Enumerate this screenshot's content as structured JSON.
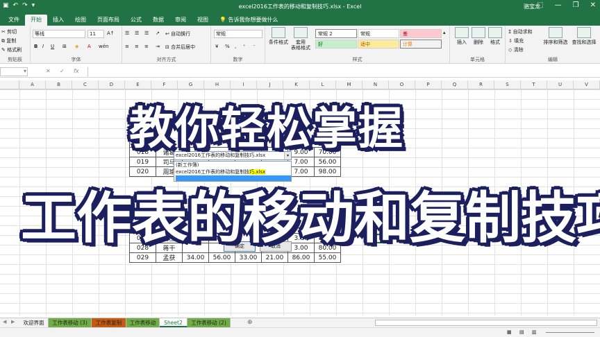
{
  "window": {
    "title": "excel2016工作表的移动和复制技巧.xlsx - Excel",
    "user": "骆宝龙",
    "controls": [
      "⬚",
      "—",
      "❐",
      "✕"
    ]
  },
  "tabs": [
    "文件",
    "开始",
    "插入",
    "绘图",
    "页面布局",
    "公式",
    "数据",
    "审阅",
    "视图"
  ],
  "tell_me": "告诉我你想要做什么",
  "ribbon": {
    "clipboard": {
      "label": "剪贴板",
      "cut": "剪切",
      "copy": "复制",
      "painter": "格式刷"
    },
    "font": {
      "label": "字体",
      "name": "等线",
      "size": "11",
      "bold": "B",
      "italic": "I",
      "underline": "U",
      "grow": "A↑",
      "shrink": "A↓",
      "wen": "wén"
    },
    "align": {
      "label": "对齐方式",
      "wrap": "自动换行",
      "merge": "合并后居中"
    },
    "number": {
      "label": "数字",
      "format": "常规",
      "percent": "%",
      "comma": ","
    },
    "styles": {
      "label": "样式",
      "cond": "条件格式",
      "table": "套用\n表格格式",
      "normal2": "常规 2",
      "normal": "常规",
      "bad": "差",
      "good": "好",
      "neutral": "适中",
      "calc": "计算"
    },
    "cells": {
      "label": "单元格",
      "insert": "插入",
      "delete": "删除",
      "format": "格式"
    },
    "editing": {
      "label": "编辑",
      "autosum": "自动求和",
      "fill": "填充",
      "clear": "清除",
      "sort": "排序和筛选",
      "find": "查找和选择"
    }
  },
  "formula_bar": {
    "x": "✕",
    "check": "✓",
    "fx": "fx",
    "caret": "▾"
  },
  "columns": [
    "A",
    "B",
    "C",
    "D",
    "E",
    "F",
    "G",
    "H",
    "I",
    "J",
    "K",
    "L",
    "M",
    "N",
    "O",
    "P",
    "Q",
    "R",
    "S",
    "T",
    "U",
    "V",
    "W"
  ],
  "table_rows": [
    [
      "018",
      "诸葛",
      "",
      "",
      "",
      "",
      "9.00",
      "70.00"
    ],
    [
      "019",
      "司马",
      "",
      "",
      "",
      "",
      "7.00",
      "56.00"
    ],
    [
      "020",
      "周瑜",
      "",
      "",
      "",
      "",
      "7.00",
      "98.00"
    ],
    [
      "027",
      "曹丕",
      "",
      "",
      "",
      "",
      "3.00",
      "82.00"
    ],
    [
      "028",
      "蒋干",
      "",
      "",
      "",
      "",
      "3.00",
      "80.00"
    ],
    [
      "029",
      "孟获",
      "34.00",
      "56.00",
      "33.00",
      "21.00",
      "86.00",
      "55.00"
    ]
  ],
  "dialog": {
    "combo": "excel2016工作表的移动和复制技巧.xlsx",
    "list_new": "(新工作簿)",
    "list_file_a": "excel2016工作表的移动和复制技",
    "list_file_b": "巧.xlsx",
    "ok": "确定",
    "cancel": "取消",
    "arrow": "▾"
  },
  "captions": {
    "line1": "教你轻松掌握",
    "line2": "工作表的移动和复制技巧"
  },
  "sheet_tabs": [
    {
      "label": "欢迎界面",
      "color": "#f3f3f3"
    },
    {
      "label": "工作表移动 (3)",
      "color": "#70ad47"
    },
    {
      "label": "工作表复制",
      "color": "#c55a11"
    },
    {
      "label": "工作表移动",
      "color": "#70ad47"
    },
    {
      "label": "Sheet2",
      "color": "#ffffff"
    },
    {
      "label": "工作表移动 (2)",
      "color": "#70ad47"
    }
  ],
  "sheet_add": "⊕",
  "colors": {
    "excel_green": "#217346",
    "caption_outline": "#1c1f5e"
  }
}
